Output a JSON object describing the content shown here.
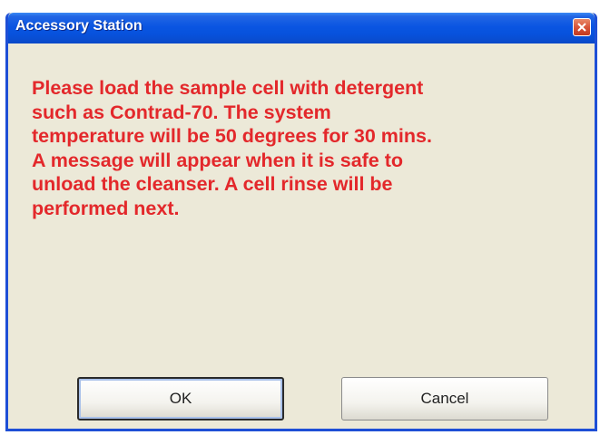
{
  "window": {
    "title": "Accessory Station",
    "close_icon": "close-icon"
  },
  "message": {
    "text": "Please load the sample cell with detergent\nsuch as Contrad-70.  The system\ntemperature will be 50 degrees for 30 mins.\nA message will appear when it is safe to\nunload the cleanser.  A cell rinse will be\nperformed next.",
    "color": "#e3282b"
  },
  "buttons": {
    "ok_label": "OK",
    "cancel_label": "Cancel"
  },
  "colors": {
    "titlebar": "#0752dc",
    "dialog_bg": "#ece9d8",
    "close_button": "#d8553a"
  }
}
